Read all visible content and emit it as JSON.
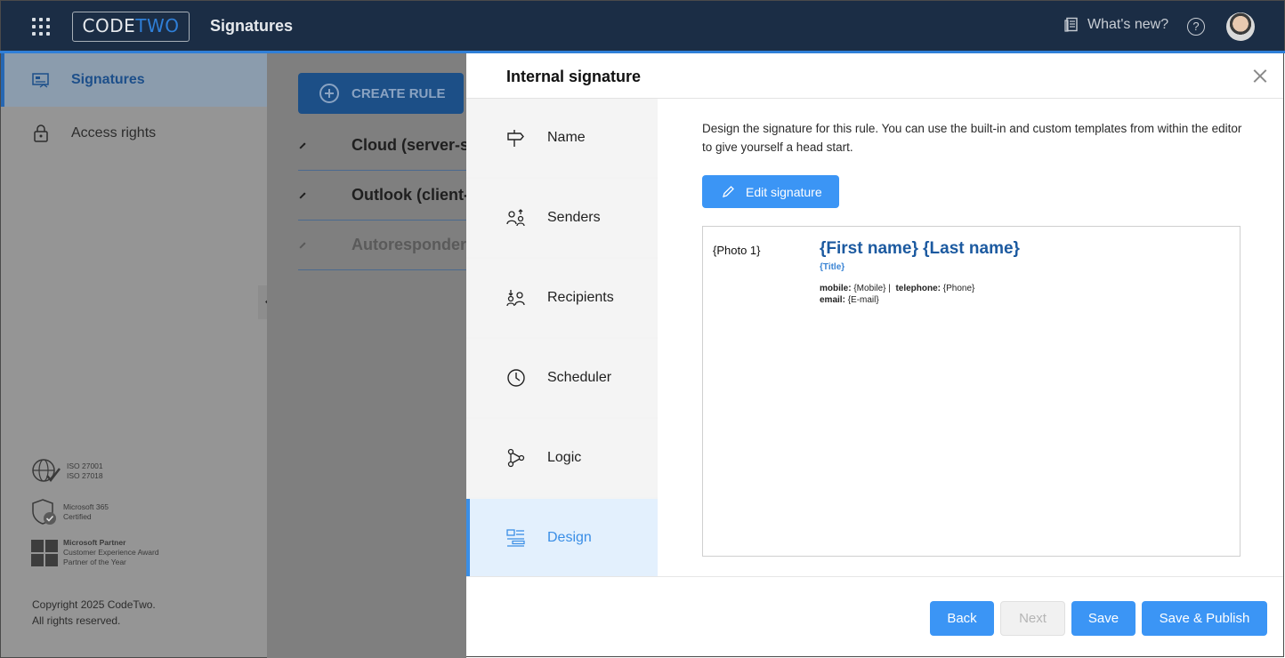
{
  "header": {
    "logo_text_main": "CODE",
    "logo_text_accent": "TWO",
    "app_title": "Signatures",
    "whats_new_label": "What's new?",
    "help_label": "?"
  },
  "sidebar": {
    "items": [
      {
        "label": "Signatures",
        "icon": "signatures-icon",
        "active": true
      },
      {
        "label": "Access rights",
        "icon": "lock-icon",
        "active": false
      }
    ],
    "certs": [
      {
        "lines": [
          "ISO 27001",
          "ISO 27018"
        ],
        "icon": "globe-check-icon"
      },
      {
        "lines": [
          "Microsoft 365",
          "Certified"
        ],
        "icon": "shield-check-icon"
      },
      {
        "lines": [
          "Microsoft Partner",
          "Customer Experience Award",
          "Partner of the Year"
        ],
        "icon": "microsoft-logo-icon"
      }
    ],
    "copyright_line1": "Copyright 2025 CodeTwo.",
    "copyright_line2": "All rights reserved."
  },
  "main": {
    "create_rule_label": "CREATE RULE",
    "rules": [
      {
        "label": "Cloud (server-side)",
        "icon": "cloud-icon",
        "disabled": false
      },
      {
        "label": "Outlook (client-side)",
        "icon": "monitor-icon",
        "disabled": false
      },
      {
        "label": "Autoresponder",
        "icon": "autoresponder-icon",
        "disabled": true
      }
    ]
  },
  "dialog": {
    "title": "Internal signature",
    "steps": [
      {
        "label": "Name",
        "icon": "signpost-icon"
      },
      {
        "label": "Senders",
        "icon": "senders-icon"
      },
      {
        "label": "Recipients",
        "icon": "recipients-icon"
      },
      {
        "label": "Scheduler",
        "icon": "clock-icon"
      },
      {
        "label": "Logic",
        "icon": "logic-icon"
      },
      {
        "label": "Design",
        "icon": "design-icon",
        "active": true
      }
    ],
    "description": "Design the signature for this rule. You can use the built-in and custom templates from within the editor to give yourself a head start.",
    "edit_signature_label": "Edit signature",
    "preview": {
      "photo": "{Photo 1}",
      "name": "{First name} {Last name}",
      "title": "{Title}",
      "mobile_label": "mobile:",
      "mobile_value": "{Mobile}",
      "separator": "|",
      "telephone_label": "telephone:",
      "telephone_value": "{Phone}",
      "email_label": "email:",
      "email_value": "{E-mail}"
    },
    "buttons": {
      "back": "Back",
      "next": "Next",
      "save": "Save",
      "save_publish": "Save & Publish"
    }
  },
  "colors": {
    "header_bg": "#1b2d45",
    "accent": "#3b95f5",
    "brand_blue": "#1c5aa0",
    "active_step_bg": "#e3f0fd"
  }
}
